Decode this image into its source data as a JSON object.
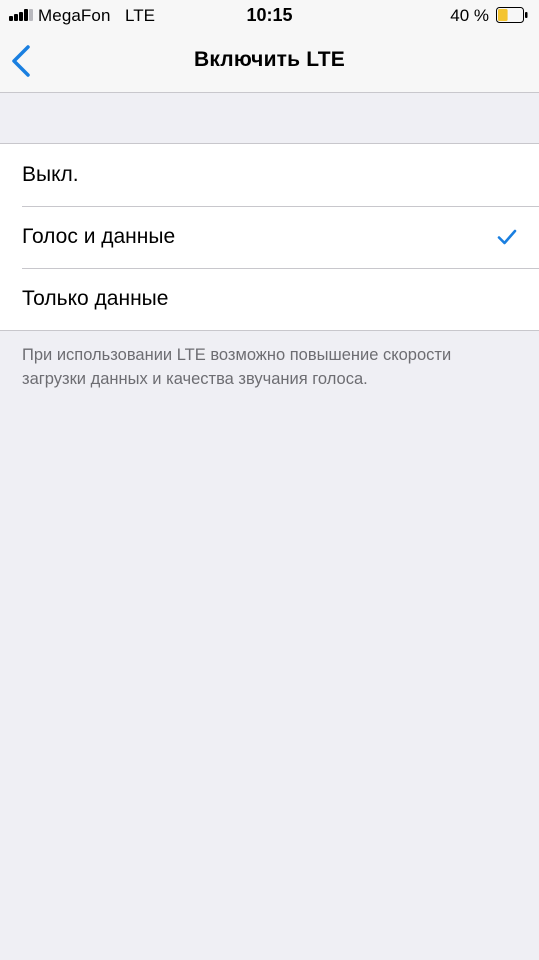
{
  "status_bar": {
    "carrier": "MegaFon",
    "network": "LTE",
    "time": "10:15",
    "battery_percent": "40 %",
    "battery_level": 0.4,
    "battery_color": "#f4c430",
    "signal_icon": "signal-bars-icon"
  },
  "nav": {
    "back_icon": "chevron-left-icon",
    "title": "Включить LTE",
    "accent_color": "#1a7fe0"
  },
  "options": [
    {
      "label": "Выкл.",
      "selected": false
    },
    {
      "label": "Голос и данные",
      "selected": true
    },
    {
      "label": "Только данные",
      "selected": false
    }
  ],
  "footer_note": "При использовании LTE возможно повышение скорости загрузки данных и качества звучания голоса."
}
